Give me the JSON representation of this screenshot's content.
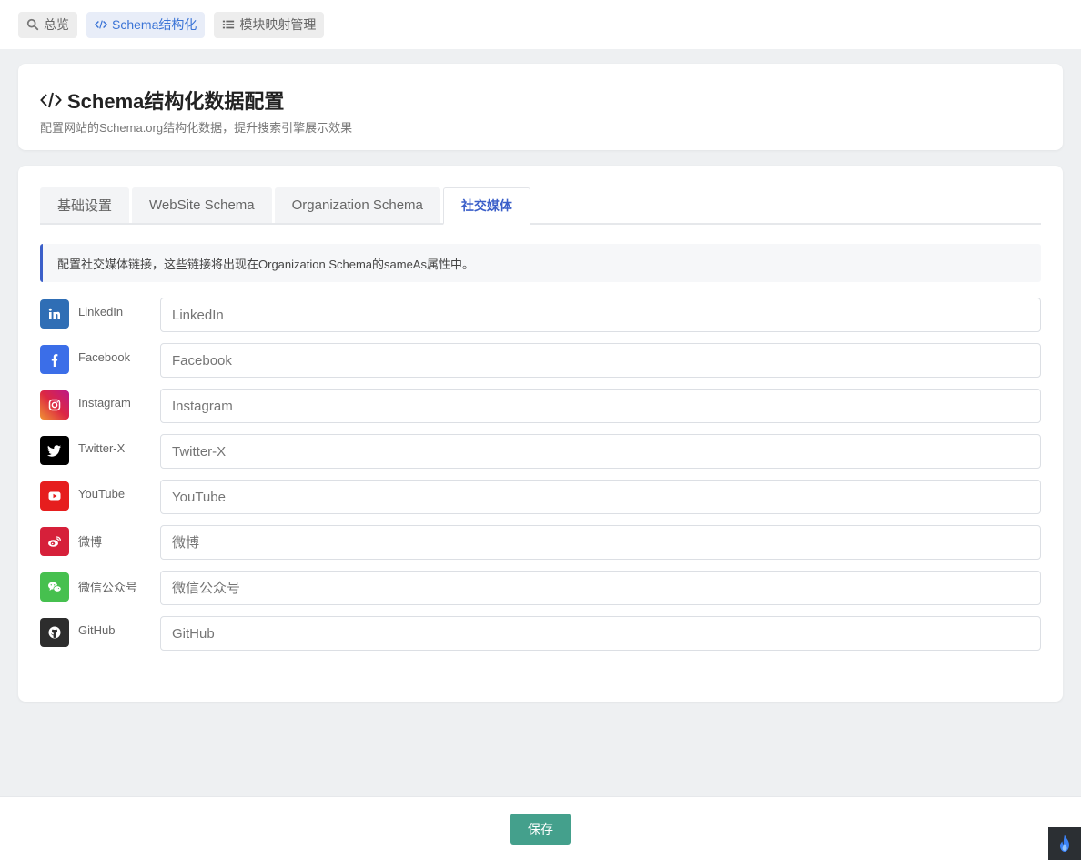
{
  "nav": {
    "items": [
      {
        "label": "总览",
        "icon": "search-icon"
      },
      {
        "label": "Schema结构化",
        "icon": "code-icon"
      },
      {
        "label": "模块映射管理",
        "icon": "list-icon"
      }
    ],
    "active_color": "#3b74d6"
  },
  "header": {
    "title": "Schema结构化数据配置",
    "subtitle": "配置网站的Schema.org结构化数据，提升搜索引擎展示效果"
  },
  "tabs": [
    "基础设置",
    "WebSite Schema",
    "Organization Schema",
    "社交媒体"
  ],
  "notice": "配置社交媒体链接，这些链接将出现在Organization Schema的sameAs属性中。",
  "social": [
    {
      "label": "LinkedIn",
      "placeholder": "LinkedIn",
      "color": "#2f6eb5",
      "icon": "linkedin-icon"
    },
    {
      "label": "Facebook",
      "placeholder": "Facebook",
      "color": "#3b6ee8",
      "icon": "facebook-icon"
    },
    {
      "label": "Instagram",
      "placeholder": "Instagram",
      "color": "#c13584",
      "icon": "instagram-icon"
    },
    {
      "label": "Twitter-X",
      "placeholder": "Twitter-X",
      "color": "#000000",
      "icon": "twitter-icon"
    },
    {
      "label": "YouTube",
      "placeholder": "YouTube",
      "color": "#e61e1e",
      "icon": "youtube-icon"
    },
    {
      "label": "微博",
      "placeholder": "微博",
      "color": "#d6203a",
      "icon": "weibo-icon"
    },
    {
      "label": "微信公众号",
      "placeholder": "微信公众号",
      "color": "#46c04f",
      "icon": "wechat-icon"
    },
    {
      "label": "GitHub",
      "placeholder": "GitHub",
      "color": "#2d2d2d",
      "icon": "github-icon"
    }
  ],
  "footer": {
    "save_label": "保存",
    "button_color": "#44a08c"
  }
}
